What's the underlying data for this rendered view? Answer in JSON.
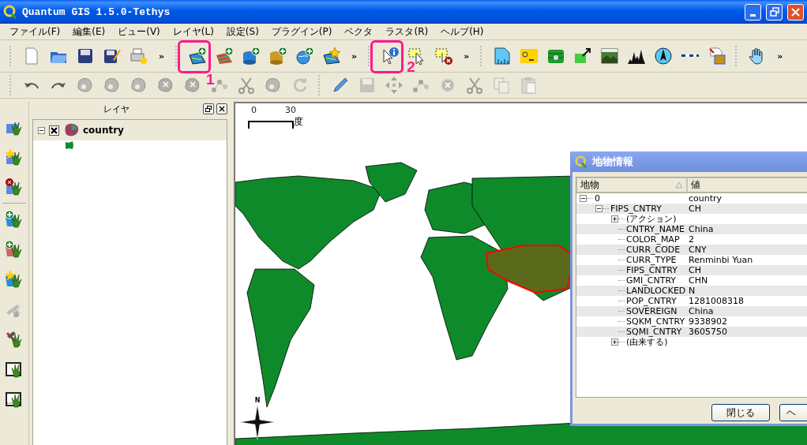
{
  "window": {
    "title": "Quantum GIS 1.5.0-Tethys"
  },
  "menu": [
    "ファイル(F)",
    "編集(E)",
    "ビュー(V)",
    "レイヤ(L)",
    "設定(S)",
    "プラグイン(P)",
    "ベクタ",
    "ラスタ(R)",
    "ヘルプ(H)"
  ],
  "toolbar_overflow": [
    "»",
    "»",
    "»",
    "»"
  ],
  "callouts": [
    {
      "label": "1"
    },
    {
      "label": "2"
    }
  ],
  "layers_panel": {
    "title": "レイヤ",
    "layers": [
      {
        "name": "country",
        "expanded": true,
        "checked": true
      }
    ]
  },
  "map": {
    "scale_labels": [
      "0",
      "30"
    ],
    "scale_unit": "度",
    "north_label": "N"
  },
  "identify_dialog": {
    "title": "地物情報",
    "columns": [
      "地物",
      "値"
    ],
    "tree": [
      {
        "key": "0",
        "value": "country",
        "expanded": true,
        "children": [
          {
            "key": "FIPS_CNTRY",
            "value": "CH",
            "expanded": true,
            "children": [
              {
                "key": "(アクション)",
                "expanded": false
              },
              {
                "key": "CNTRY_NAME",
                "value": "China"
              },
              {
                "key": "COLOR_MAP",
                "value": "2"
              },
              {
                "key": "CURR_CODE",
                "value": "CNY"
              },
              {
                "key": "CURR_TYPE",
                "value": "Renminbi Yuan"
              },
              {
                "key": "FIPS_CNTRY",
                "value": "CH"
              },
              {
                "key": "GMI_CNTRY",
                "value": "CHN"
              },
              {
                "key": "LANDLOCKED",
                "value": "N"
              },
              {
                "key": "POP_CNTRY",
                "value": "1281008318"
              },
              {
                "key": "SOVEREIGN",
                "value": "China"
              },
              {
                "key": "SQKM_CNTRY",
                "value": "9338902"
              },
              {
                "key": "SQMI_CNTRY",
                "value": "3605750"
              },
              {
                "key": "(由来する)",
                "expanded": false
              }
            ]
          }
        ]
      }
    ],
    "buttons": [
      "閉じる",
      "ヘ"
    ]
  }
}
